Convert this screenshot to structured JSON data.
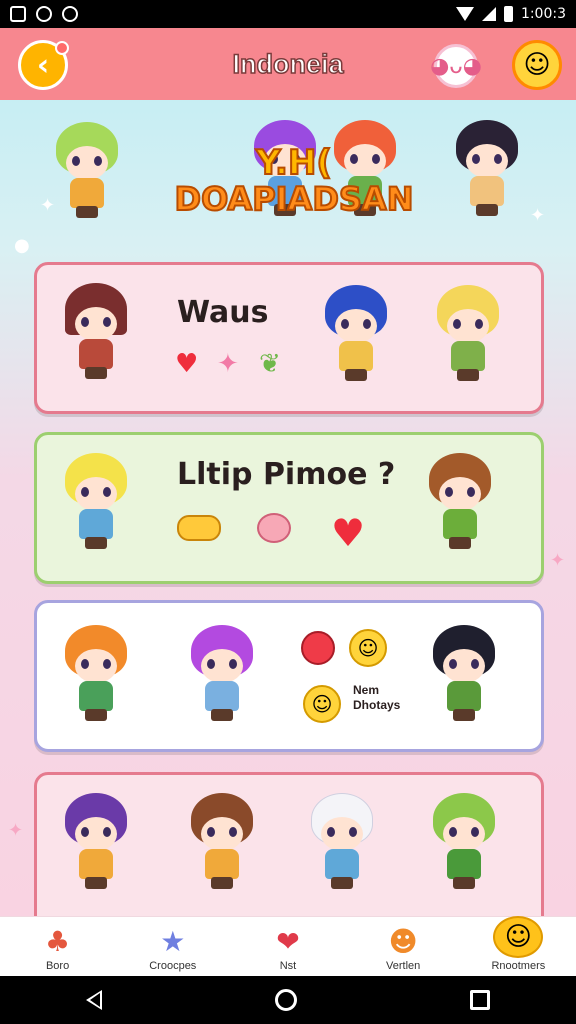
{
  "status_bar": {
    "time": "1:00:3"
  },
  "header": {
    "title": "Indoneia",
    "back_icon": "arrow-left-icon",
    "mascot_icon": "ghost-mascot-icon",
    "profile_icon": "smiling-face-icon"
  },
  "banner": {
    "title_line1": "Y.H(",
    "title_line2": "DOAPIADSAN"
  },
  "cards": [
    {
      "title": "Waus",
      "stickers": [
        "heart-icon",
        "star-icon",
        "leaf-icon"
      ]
    },
    {
      "title": "Lltip Pimoe ?",
      "stickers": [
        "pill-icon",
        "blob-icon",
        "heart-icon"
      ]
    },
    {
      "small_line1": "Nem",
      "small_line2": "Dhotays",
      "stickers": [
        "red-ball-icon",
        "smiley-icon",
        "smiley-icon"
      ]
    },
    {
      "stickers": []
    }
  ],
  "bottom_nav": {
    "items": [
      {
        "label": "Boro",
        "icon": "mushroom-icon"
      },
      {
        "label": "Croocpes",
        "icon": "star-icon"
      },
      {
        "label": "Nst",
        "icon": "heart-badge-icon"
      },
      {
        "label": "Vertlen",
        "icon": "fox-face-icon"
      },
      {
        "label": "Rnootmers",
        "icon": "smiley-icon"
      }
    ]
  },
  "colors": {
    "header_bg": "#f7878f",
    "card1_bg": "#fbe3ea",
    "card2_bg": "#eaf5dc",
    "card3_bg": "#ffffff",
    "card4_bg": "#fbe3ea"
  }
}
